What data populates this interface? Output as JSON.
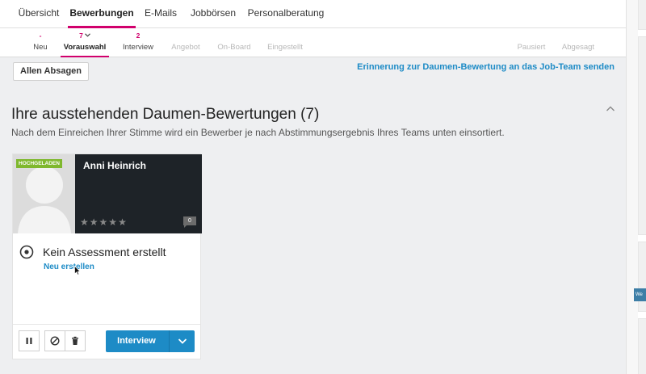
{
  "top_nav": {
    "tabs": [
      {
        "label": "Übersicht"
      },
      {
        "label": "Bewerbungen"
      },
      {
        "label": "E-Mails"
      },
      {
        "label": "Jobbörsen"
      },
      {
        "label": "Personalberatung"
      }
    ],
    "active": "Bewerbungen"
  },
  "stage_nav": {
    "stages": [
      {
        "count": "-",
        "label": "Neu"
      },
      {
        "count": "7",
        "label": "Vorauswahl"
      },
      {
        "count": "2",
        "label": "Interview"
      },
      {
        "count": "",
        "label": "Angebot"
      },
      {
        "count": "",
        "label": "On-Board"
      },
      {
        "count": "",
        "label": "Eingestellt"
      },
      {
        "count": "",
        "label": "Pausiert"
      },
      {
        "count": "",
        "label": "Abgesagt"
      }
    ],
    "active": "Vorauswahl"
  },
  "toolbar": {
    "reject_all_label": "Allen Absagen",
    "reminder_link": "Erinnerung zur Daumen-Bewertung an das Job-Team senden"
  },
  "section": {
    "title": "Ihre ausstehenden Daumen-Bewertungen (7)",
    "subtitle": "Nach dem Einreichen Ihrer Stimme wird ein Bewerber je nach Abstimmungsergebnis Ihres Teams unten einsortiert."
  },
  "card": {
    "badge": "HOCHGELADEN",
    "name": "Anni Heinrich",
    "rating": 0,
    "rating_max": 5,
    "comment_count": "0",
    "assessment_title": "Kein Assessment erstellt",
    "assessment_link": "Neu erstellen",
    "interview_button": "Interview"
  },
  "colors": {
    "accent": "#d1006c",
    "primary_button": "#1d8bc6",
    "link": "#1d8bc6",
    "badge": "#7fb82e"
  },
  "right_strip_text": "We"
}
